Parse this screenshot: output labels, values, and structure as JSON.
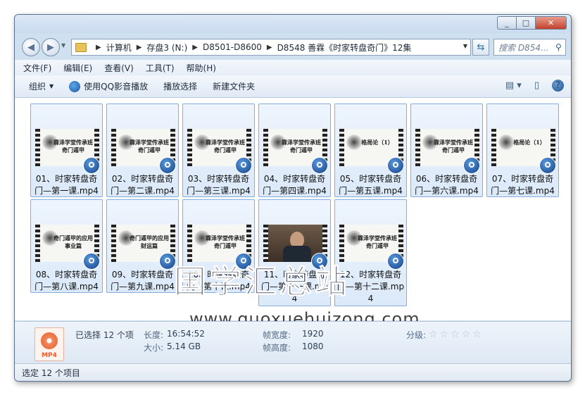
{
  "window": {
    "minimize": "_",
    "maximize": "□",
    "close": "✕"
  },
  "address": {
    "crumbs": [
      "计算机",
      "存盘3 (N:)",
      "D8501-D8600",
      "D8548 善霖《时家转盘奇门》12集"
    ],
    "search_placeholder": "搜索 D854...",
    "nav_back_icon": "arrow-left-icon",
    "nav_forward_icon": "arrow-right-icon"
  },
  "menu": [
    "文件(F)",
    "编辑(E)",
    "查看(V)",
    "工具(T)",
    "帮助(H)"
  ],
  "toolbar": {
    "organize": "组织",
    "play_qq": "使用QQ影音播放",
    "playlist": "播放选择",
    "new_folder": "新建文件夹"
  },
  "files": [
    {
      "name": "01、时家转盘奇门—第一课.mp4",
      "thumb": "霖泽学堂传承班 奇门遁甲"
    },
    {
      "name": "02、时家转盘奇门—第二课.mp4",
      "thumb": "霖泽学堂传承班 奇门遁甲"
    },
    {
      "name": "03、时家转盘奇门—第三课.mp4",
      "thumb": "霖泽学堂传承班 奇门遁甲"
    },
    {
      "name": "04、时家转盘奇门—第四课.mp4",
      "thumb": "霖泽学堂传承班 奇门遁甲"
    },
    {
      "name": "05、时家转盘奇门—第五课.mp4",
      "thumb": "格局论（1）"
    },
    {
      "name": "06、时家转盘奇门—第六课.mp4",
      "thumb": "霖泽学堂传承班 奇门遁甲"
    },
    {
      "name": "07、时家转盘奇门—第七课.mp4",
      "thumb": "格局论（1）"
    },
    {
      "name": "08、时家转盘奇门—第八课.mp4",
      "thumb": "奇门遁甲的应用 事业篇"
    },
    {
      "name": "09、时家转盘奇门—第九课.mp4",
      "thumb": "奇门遁甲的应用 财运篇"
    },
    {
      "name": "10、时家转盘奇门—第十课.mp4",
      "thumb": "霖泽学堂传承班 奇门遁甲"
    },
    {
      "name": "11、时家转盘奇门—第十一课.mp4",
      "thumb": ""
    },
    {
      "name": "12、时家转盘奇门—第十二课.mp4",
      "thumb": "霖泽学堂传承班 奇门遁甲"
    }
  ],
  "watermark": {
    "cn": "国学汇总站",
    "url": "www.guoxuehuizong.com"
  },
  "details": {
    "selected": "已选择 12 个项",
    "length_label": "长度:",
    "length_value": "16:54:52",
    "size_label": "大小:",
    "size_value": "5.14 GB",
    "width_label": "帧宽度:",
    "width_value": "1920",
    "height_label": "帧高度:",
    "height_value": "1080",
    "rating_label": "分级:",
    "icon_label": "MP4"
  },
  "status": "选定 12 个项目"
}
